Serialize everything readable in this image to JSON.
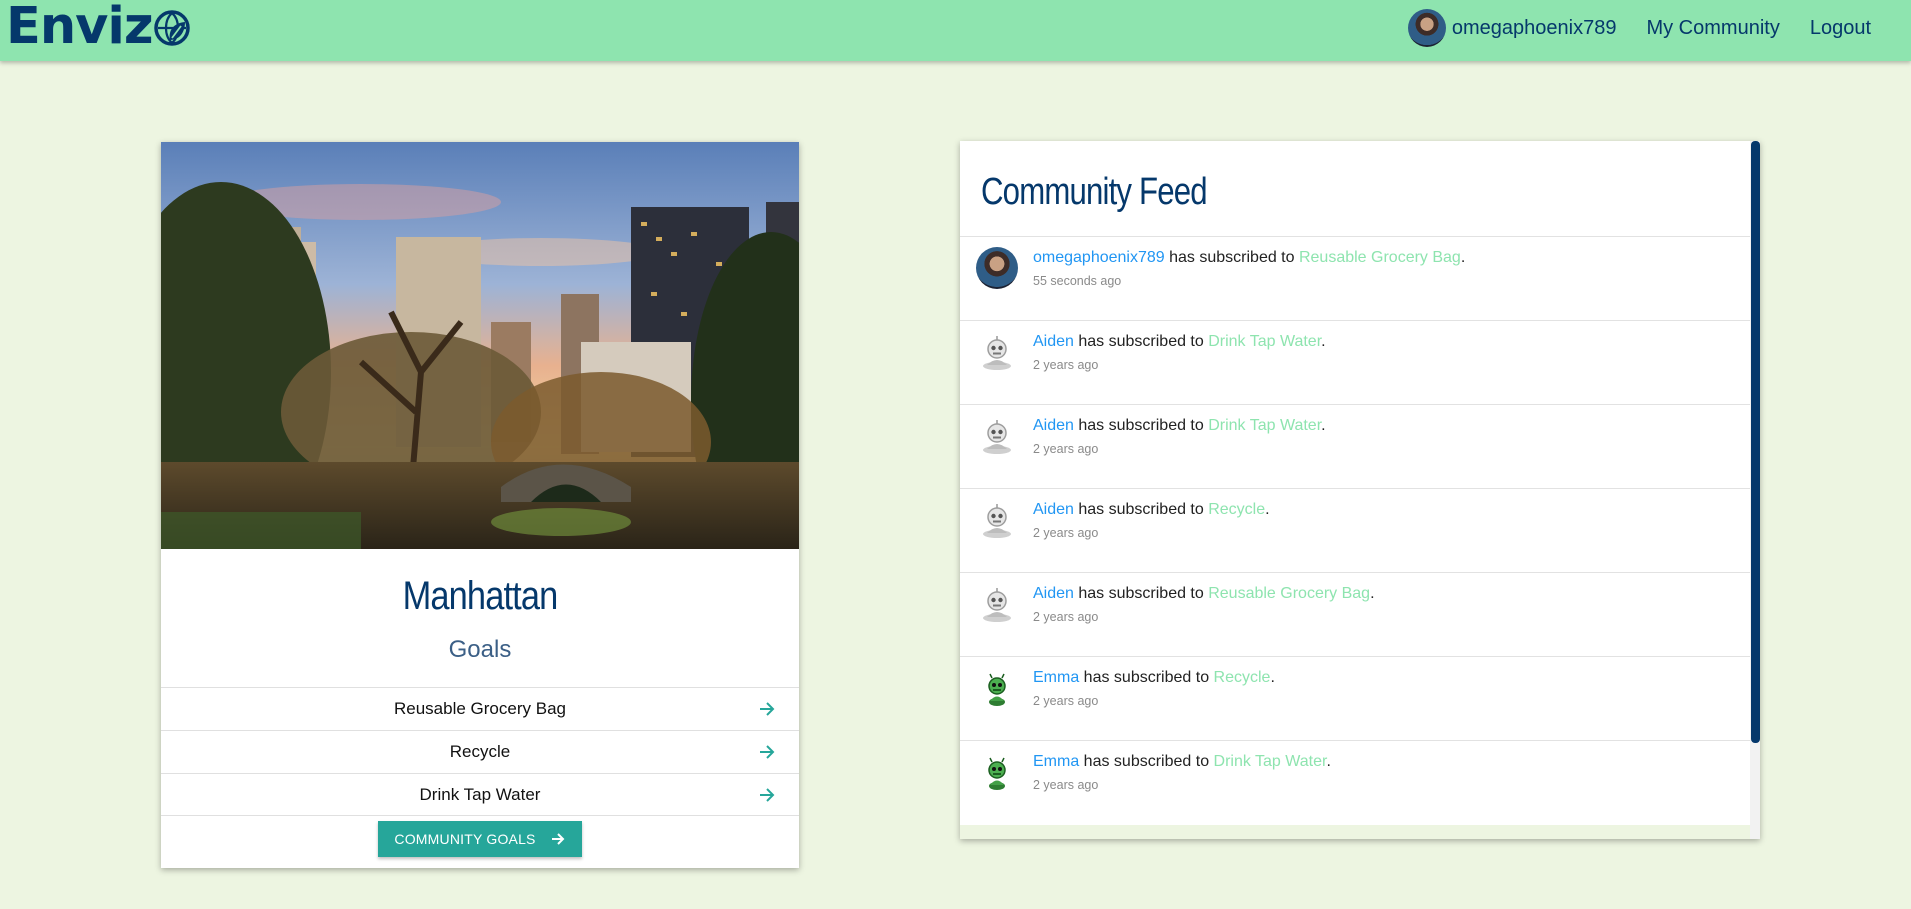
{
  "navbar": {
    "brand": "Enviz",
    "brand_icon": "globe-leaf-icon",
    "username": "omegaphoenix789",
    "links": [
      "My Community",
      "Logout"
    ]
  },
  "community": {
    "name": "Manhattan",
    "subtitle": "Goals",
    "goals": [
      "Reusable Grocery Bag",
      "Recycle",
      "Drink Tap Water"
    ],
    "button_label": "COMMUNITY GOALS",
    "accent": "#26a69a"
  },
  "feed": {
    "title": "Community Feed",
    "connector": " has subscribed to ",
    "items": [
      {
        "user": "omegaphoenix789",
        "goal": "Reusable Grocery Bag",
        "time": "55 seconds ago",
        "avatar": "user-photo"
      },
      {
        "user": "Aiden",
        "goal": "Drink Tap Water",
        "time": "2 years ago",
        "avatar": "robot"
      },
      {
        "user": "Aiden",
        "goal": "Drink Tap Water",
        "time": "2 years ago",
        "avatar": "robot"
      },
      {
        "user": "Aiden",
        "goal": "Recycle",
        "time": "2 years ago",
        "avatar": "robot"
      },
      {
        "user": "Aiden",
        "goal": "Reusable Grocery Bag",
        "time": "2 years ago",
        "avatar": "robot"
      },
      {
        "user": "Emma",
        "goal": "Recycle",
        "time": "2 years ago",
        "avatar": "green-alien"
      },
      {
        "user": "Emma",
        "goal": "Drink Tap Water",
        "time": "2 years ago",
        "avatar": "green-alien"
      }
    ]
  },
  "colors": {
    "navbar": "#8ee4af",
    "background": "#edf5e1",
    "primary": "#05386b",
    "link": "#2196f3",
    "goal_link": "#8ee4af"
  }
}
